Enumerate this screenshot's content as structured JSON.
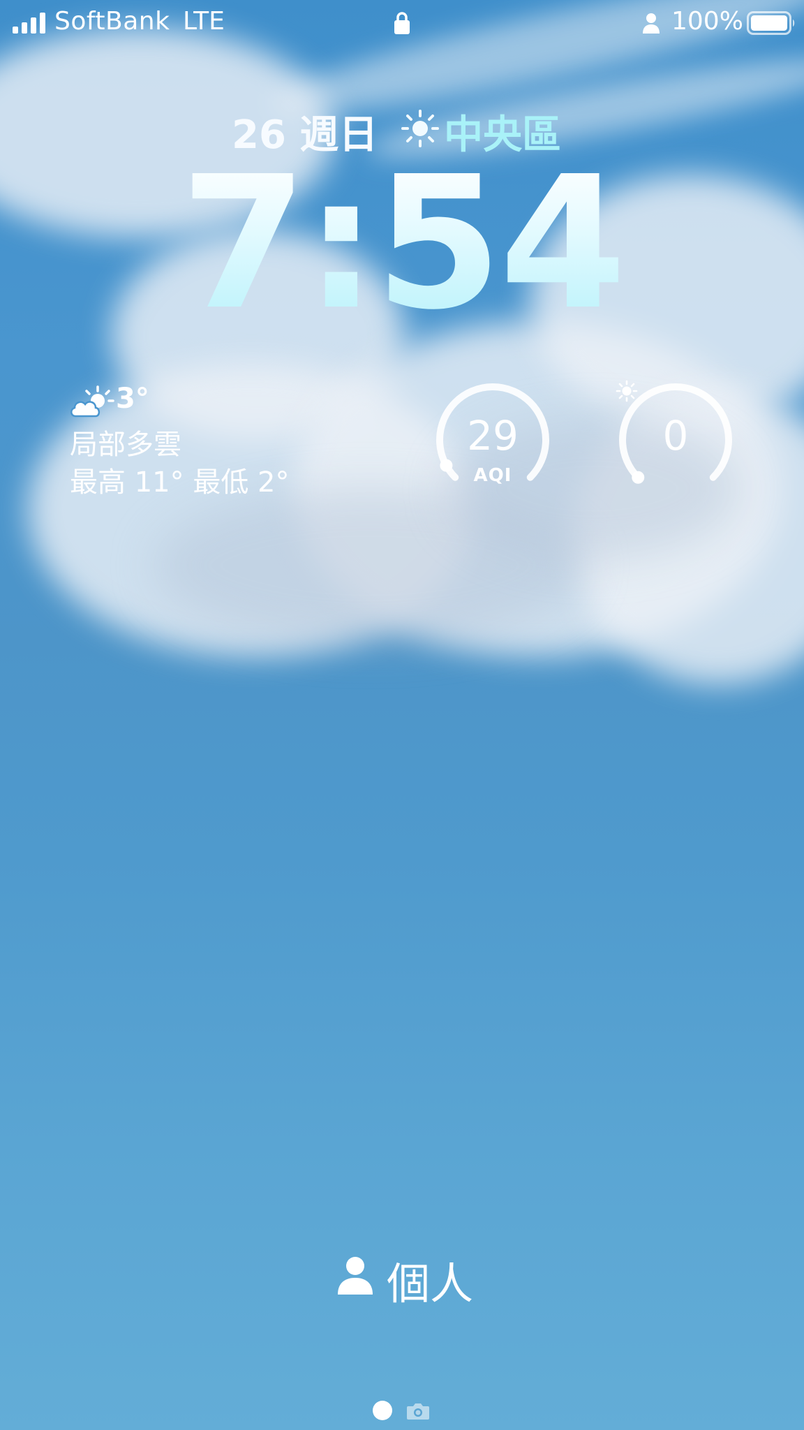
{
  "status_bar": {
    "carrier": "SoftBank",
    "network": "LTE",
    "battery_percent": "100%",
    "signal_icon": "signal-bars-icon",
    "lock_icon": "lock-icon",
    "person_icon": "person-icon",
    "battery_icon": "battery-icon"
  },
  "lock_screen": {
    "date": "26 週日",
    "location": "中央區",
    "location_icon": "sun-icon",
    "time": "7:54"
  },
  "widgets": {
    "weather": {
      "icon": "partly-cloudy-icon",
      "temperature": "3°",
      "condition": "局部多雲",
      "hi_lo": "最高 11° 最低 2°"
    },
    "aqi": {
      "value": "29",
      "label": "AQI",
      "level": 0.06
    },
    "uv": {
      "value": "0",
      "icon": "sun-icon",
      "level": 0.0
    }
  },
  "focus": {
    "icon": "person-icon",
    "label": "個人"
  },
  "page_indicator": {
    "current_page": 1,
    "camera_icon": "camera-icon"
  },
  "colors": {
    "accent_location": "#a9f2f8",
    "text": "#ffffff",
    "sky": "#4a96cf"
  }
}
